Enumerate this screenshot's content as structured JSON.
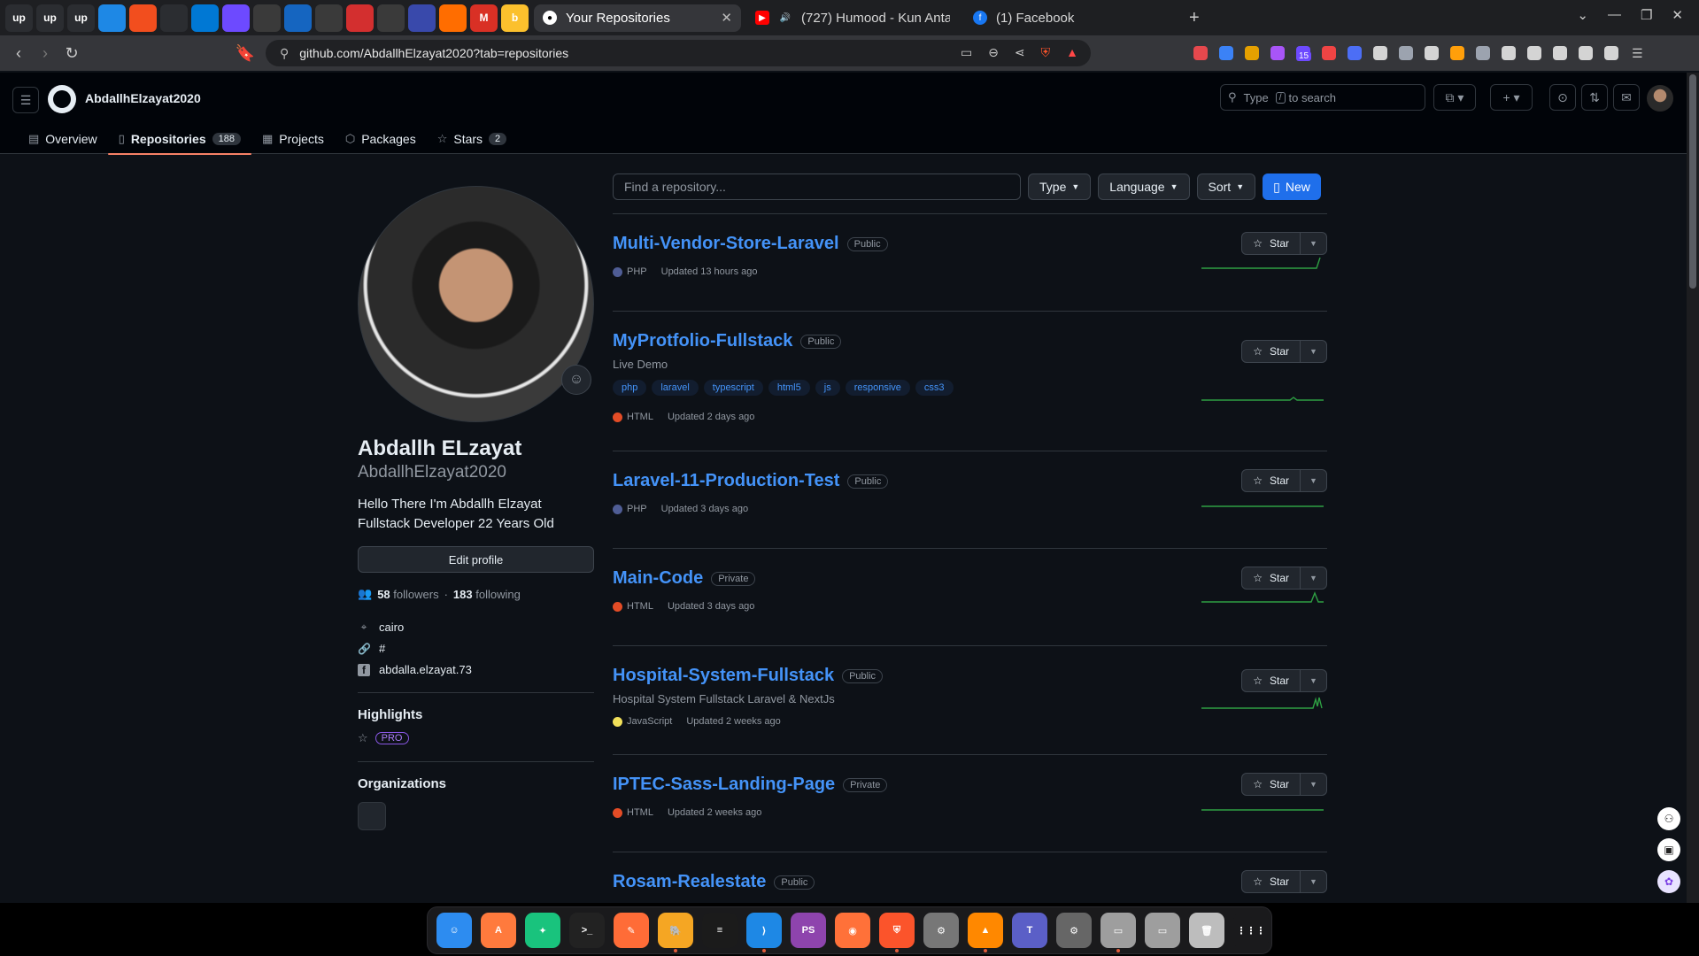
{
  "browser": {
    "pinned_tabs": [
      {
        "icon": "upwork-icon",
        "text": "up",
        "color": "#2b2d31"
      },
      {
        "icon": "upwork-icon",
        "text": "up",
        "color": "#2b2d31"
      },
      {
        "icon": "upwork-icon",
        "text": "up",
        "color": "#2b2d31"
      },
      {
        "icon": "circle-app-icon",
        "text": "",
        "color": "#1e88e5"
      },
      {
        "icon": "figma-icon",
        "text": "",
        "color": "#f24e1e"
      },
      {
        "icon": "github-icon",
        "text": "",
        "color": "#2b2d31"
      },
      {
        "icon": "outlook-icon",
        "text": "",
        "color": "#0078d4"
      },
      {
        "icon": "proton-icon",
        "text": "",
        "color": "#6d4aff"
      },
      {
        "icon": "linear-icon",
        "text": "",
        "color": "#3a3a3a"
      },
      {
        "icon": "database-icon",
        "text": "",
        "color": "#1565c0"
      },
      {
        "icon": "notion-icon",
        "text": "",
        "color": "#3a3a3a"
      },
      {
        "icon": "flag-icon",
        "text": "",
        "color": "#d32f2f"
      },
      {
        "icon": "openai-icon",
        "text": "",
        "color": "#3a3a3a"
      },
      {
        "icon": "cursor-icon",
        "text": "",
        "color": "#3949ab"
      },
      {
        "icon": "fire-icon",
        "text": "",
        "color": "#ff6d00"
      },
      {
        "icon": "gmail-icon",
        "text": "M",
        "color": "#d93025"
      },
      {
        "icon": "b-icon",
        "text": "b",
        "color": "#fbc02d"
      }
    ],
    "tabs": [
      {
        "label": "Your Repositories",
        "icon": "github-icon",
        "active": true,
        "close": "✕"
      },
      {
        "label": "(727) Humood - Kun Anta",
        "icon": "youtube-icon",
        "active": false,
        "close": ""
      },
      {
        "label": "(1) Facebook",
        "icon": "facebook-icon",
        "active": false,
        "close": ""
      }
    ],
    "new_tab": "+",
    "url": "github.com/AbdallhElzayat2020?tab=repositories",
    "extension_badge": "15"
  },
  "header": {
    "username": "AbdallhElzayat2020",
    "search_placeholder_prefix": "Type",
    "search_slash": "/",
    "search_placeholder_suffix": "to search"
  },
  "nav_tabs": [
    {
      "label": "Overview",
      "icon": "book-icon",
      "count": ""
    },
    {
      "label": "Repositories",
      "icon": "repo-icon",
      "count": "188"
    },
    {
      "label": "Projects",
      "icon": "table-icon",
      "count": ""
    },
    {
      "label": "Packages",
      "icon": "package-icon",
      "count": ""
    },
    {
      "label": "Stars",
      "icon": "star-icon",
      "count": "2"
    }
  ],
  "profile": {
    "name": "Abdallh ELzayat",
    "login": "AbdallhElzayat2020",
    "bio_line1": "Hello There I'm Abdallh Elzayat",
    "bio_line2": "Fullstack Developer 22 Years Old",
    "edit_label": "Edit profile",
    "followers": "58",
    "followers_label": "followers",
    "following": "183",
    "following_label": "following",
    "dot": "·",
    "location": "cairo",
    "website": "#",
    "facebook": "abdalla.elzayat.73",
    "highlights_title": "Highlights",
    "pro_label": "PRO",
    "organizations_title": "Organizations"
  },
  "filters": {
    "find_placeholder": "Find a repository...",
    "type_label": "Type",
    "language_label": "Language",
    "sort_label": "Sort",
    "new_label": "New"
  },
  "repos": [
    {
      "name": "Multi-Vendor-Store-Laravel",
      "visibility": "Public",
      "description": "",
      "topics": [],
      "language": "PHP",
      "lang_color": "#4F5D95",
      "updated": "Updated 13 hours ago",
      "star_label": "Star"
    },
    {
      "name": "MyProtfolio-Fullstack",
      "visibility": "Public",
      "description": "Live Demo",
      "topics": [
        "php",
        "laravel",
        "typescript",
        "html5",
        "js",
        "responsive",
        "css3"
      ],
      "language": "HTML",
      "lang_color": "#e34c26",
      "updated": "Updated 2 days ago",
      "star_label": "Star"
    },
    {
      "name": "Laravel-11-Production-Test",
      "visibility": "Public",
      "description": "",
      "topics": [],
      "language": "PHP",
      "lang_color": "#4F5D95",
      "updated": "Updated 3 days ago",
      "star_label": "Star"
    },
    {
      "name": "Main-Code",
      "visibility": "Private",
      "description": "",
      "topics": [],
      "language": "HTML",
      "lang_color": "#e34c26",
      "updated": "Updated 3 days ago",
      "star_label": "Star"
    },
    {
      "name": "Hospital-System-Fullstack",
      "visibility": "Public",
      "description": "Hospital System Fullstack Laravel & NextJs",
      "topics": [],
      "language": "JavaScript",
      "lang_color": "#f1e05a",
      "updated": "Updated 2 weeks ago",
      "star_label": "Star"
    },
    {
      "name": "IPTEC-Sass-Landing-Page",
      "visibility": "Private",
      "description": "",
      "topics": [],
      "language": "HTML",
      "lang_color": "#e34c26",
      "updated": "Updated 2 weeks ago",
      "star_label": "Star"
    },
    {
      "name": "Rosam-Realestate",
      "visibility": "Public",
      "description": "",
      "topics": [],
      "language": "",
      "lang_color": "",
      "updated": "",
      "star_label": "Star"
    }
  ],
  "dock": [
    {
      "icon": "finder-icon",
      "color": "#2d8cf0"
    },
    {
      "icon": "app-store-icon",
      "color": "#ff7a3d"
    },
    {
      "icon": "chatgpt-icon",
      "color": "#19c37d"
    },
    {
      "icon": "terminal-icon",
      "color": "#222"
    },
    {
      "icon": "postman-icon",
      "color": "#ff6c37"
    },
    {
      "icon": "tableplus-icon",
      "color": "#f5a623"
    },
    {
      "icon": "sheets-icon",
      "color": "#1b1b1b"
    },
    {
      "icon": "vscode-icon",
      "color": "#1e88e5"
    },
    {
      "icon": "phpstorm-icon",
      "color": "#8e44ad"
    },
    {
      "icon": "firefox-icon",
      "color": "#ff7139"
    },
    {
      "icon": "brave-icon",
      "color": "#fb542b"
    },
    {
      "icon": "settings-icon",
      "color": "#777"
    },
    {
      "icon": "vlc-icon",
      "color": "#ff8800"
    },
    {
      "icon": "teams-icon",
      "color": "#5b5fc7"
    },
    {
      "icon": "system-settings-icon",
      "color": "#666"
    },
    {
      "icon": "disk-icon",
      "color": "#9e9e9e"
    },
    {
      "icon": "disk-icon",
      "color": "#9e9e9e"
    },
    {
      "icon": "trash-icon",
      "color": "#bdbdbd"
    },
    {
      "icon": "apps-grid-icon",
      "color": "#1a1a1c"
    }
  ]
}
